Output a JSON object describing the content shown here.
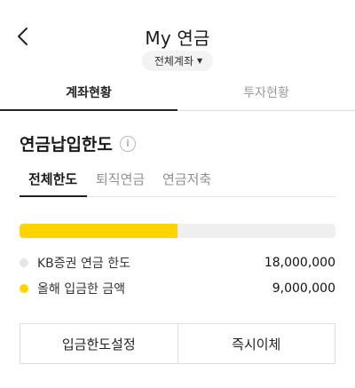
{
  "header": {
    "title": "My 연금",
    "account_selector": "전체계좌",
    "back_icon": "chevron-left-icon"
  },
  "tabs": [
    {
      "label": "계좌현황",
      "active": true
    },
    {
      "label": "투자현황",
      "active": false
    }
  ],
  "section": {
    "title": "연금납입한도",
    "info_icon": "info-icon"
  },
  "subtabs": [
    {
      "label": "전체한도",
      "active": true
    },
    {
      "label": "퇴직연금",
      "active": false
    },
    {
      "label": "연금저축",
      "active": false
    }
  ],
  "limit": {
    "progress_fraction": 0.5,
    "legend": [
      {
        "label": "KB증권 연금 한도",
        "value": "18,000,000",
        "color": "#e6e6e6"
      },
      {
        "label": "올해 입금한 금액",
        "value": "9,000,000",
        "color": "#ffd400"
      }
    ]
  },
  "actions": {
    "set_limit_label": "입금한도설정",
    "transfer_label": "즉시이체"
  },
  "colors": {
    "accent": "#ffd400",
    "track": "#efefef"
  }
}
